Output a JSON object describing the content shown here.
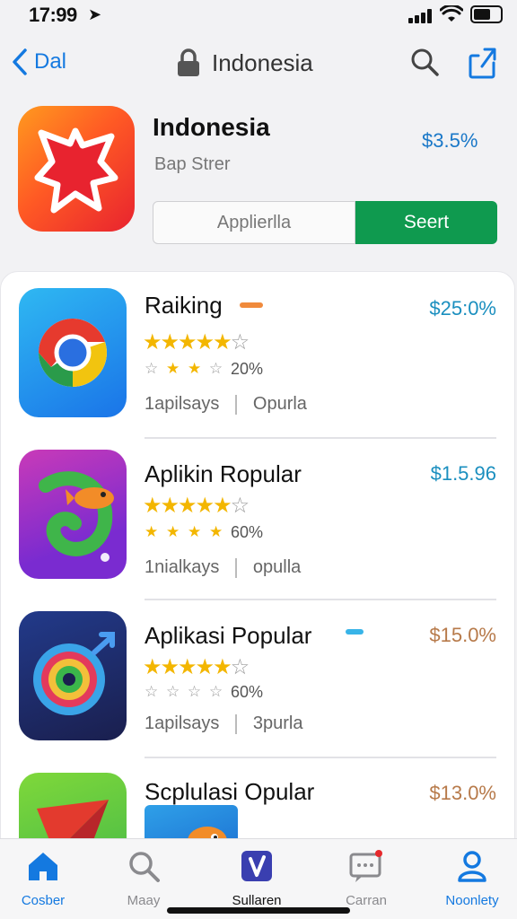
{
  "status_bar": {
    "time": "17:99"
  },
  "nav": {
    "back_label": "Dal",
    "title": "Indonesia"
  },
  "featured": {
    "name": "Indonesia",
    "subtitle": "Bap Strer",
    "price": "$3.5%",
    "secondary_button": "Applierlla",
    "primary_button": "Seert"
  },
  "apps": [
    {
      "title": "Raiking",
      "price": "$25:0%",
      "rating_pct": "20%",
      "meta_left": "1apilsays",
      "meta_right": "Opurla",
      "price_color": "#1b8fbf"
    },
    {
      "title": "Aplikin Ropular",
      "price": "$1.5.96",
      "rating_pct": "60%",
      "meta_left": "1nialkays",
      "meta_right": "opulla",
      "price_color": "#1b8fbf"
    },
    {
      "title": "Aplikasi Popular",
      "price": "$15.0%",
      "rating_pct": "60%",
      "meta_left": "1apilsays",
      "meta_right": "3purla",
      "price_color": "#b77a4a"
    },
    {
      "title": "Scplulasi Opular",
      "price": "$13.0%",
      "price_color": "#b77a4a"
    }
  ],
  "tabs": [
    {
      "label": "Cosber",
      "icon": "home-icon",
      "active": true
    },
    {
      "label": "Maay",
      "icon": "search-icon",
      "active": false
    },
    {
      "label": "Sullaren",
      "icon": "apps-icon",
      "active": false
    },
    {
      "label": "Carran",
      "icon": "chat-icon",
      "active": false
    },
    {
      "label": "Noonlety",
      "icon": "profile-icon",
      "active": true
    }
  ],
  "colors": {
    "accent_blue": "#1479e0",
    "primary_green": "#0f9a4f",
    "star_gold": "#f3b600"
  }
}
